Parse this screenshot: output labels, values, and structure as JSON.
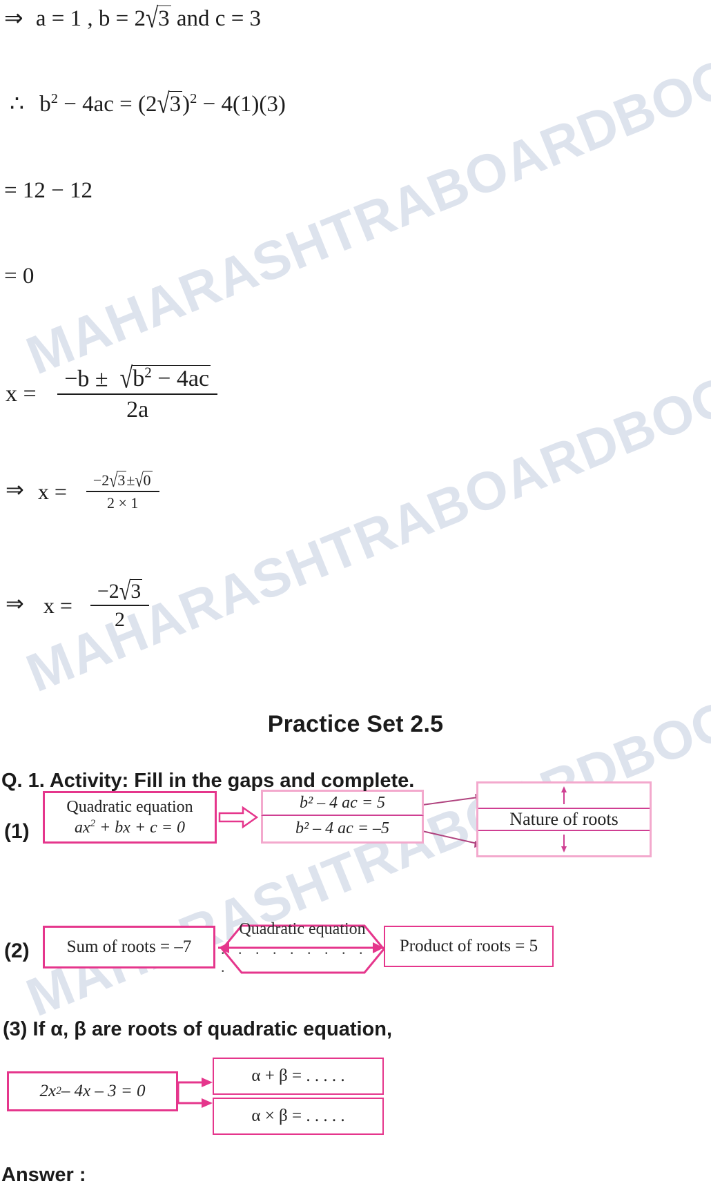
{
  "watermark": {
    "text": "MAHARASHTRABOARDBOOKS.CO",
    "color": "#c3cde0"
  },
  "solution_steps": {
    "step1_prefix": "⇒",
    "step1": "a  =  1 , b  =  2",
    "step1_radicand": "3",
    "step1_tail": " and c  =  3",
    "step2_prefix": "∴",
    "step2_lhs_b": "b",
    "step2_lhs_rest": " − 4ac  =  (2",
    "step2_radicand": "3",
    "step2_tail": ")",
    "step2_tail2": " − 4(1)(3)",
    "step3": "=  12 − 12",
    "step4": "=  0"
  },
  "quadratic_formula": {
    "lhs": "x  =",
    "numerator_lead": "−b ±",
    "numerator_radicand_b": "b",
    "numerator_radicand_rest": " − 4ac",
    "denominator": "2a"
  },
  "substituted_formula": {
    "prefix": "⇒",
    "lhs": "x  =",
    "num_lead": "−2",
    "num_rad1": "3",
    "num_pm": "±",
    "num_rad2": "0",
    "den": "2 × 1"
  },
  "final_value": {
    "prefix": "⇒",
    "lhs": "x  =",
    "num_lead": "−2",
    "num_rad": "3",
    "den": "2"
  },
  "practice_set": {
    "title": "Practice Set 2.5"
  },
  "question1": {
    "text": "Q. 1. Activity: Fill in the gaps and complete."
  },
  "activity": {
    "row1": {
      "index": "(1)",
      "source_box": {
        "line1": "Quadratic equation",
        "line2_a": "ax",
        "line2_b": " + bx + c = 0"
      },
      "mid_box_top": "b² – 4 ac = 5",
      "mid_box_bottom": "b² – 4 ac = –5",
      "result_box": "Nature of roots"
    },
    "row2": {
      "index": "(2)",
      "left_box": "Sum of roots = –7",
      "hex_label": "Quadratic equation",
      "hex_blank": ". . . . . . . . . .",
      "right_box": "Product of roots = 5"
    },
    "row3": {
      "index": "(3)",
      "text": "If α, β are roots of quadratic equation,",
      "equation_box_a": "2x",
      "equation_box_b": " – 4x – 3 = 0",
      "out_box_top": "α + β = . . . . .",
      "out_box_bottom": "α × β = . . . . ."
    }
  },
  "answer": {
    "label": "Answer :"
  },
  "colors": {
    "accent_pink": "#e5368c",
    "light_pink": "#f3a9cd",
    "mid_pink": "#cf3f92",
    "text": "#1c1c1c"
  }
}
